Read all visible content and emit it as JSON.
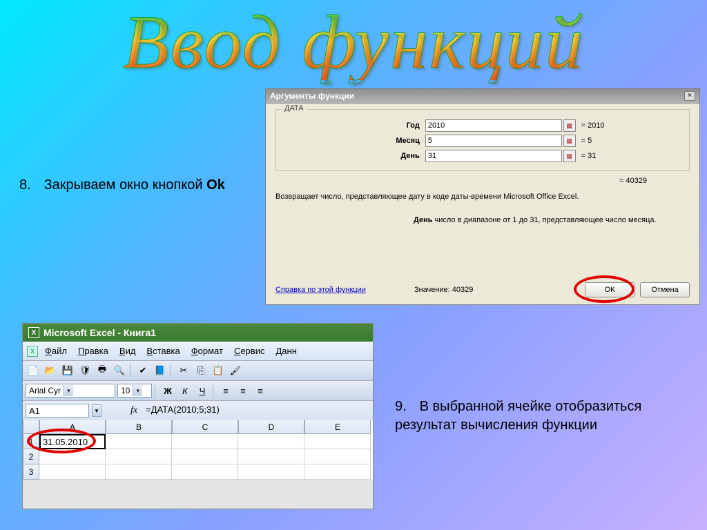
{
  "title": "Ввод функций",
  "instruction8": {
    "num": "8.",
    "text": "Закрываем окно кнопкой ",
    "bold": "Ok"
  },
  "instruction9": {
    "num": "9.",
    "text": "В выбранной ячейке отобразиться результат вычисления функции"
  },
  "dialog": {
    "title": "Аргументы функции",
    "group": "ДАТА",
    "args": [
      {
        "label": "Год",
        "value": "2010",
        "eq": "= 2010"
      },
      {
        "label": "Месяц",
        "value": "5",
        "eq": "= 5"
      },
      {
        "label": "День",
        "value": "31",
        "eq": "= 31"
      }
    ],
    "result_eq": "= 40329",
    "description": "Возвращает число, представляющее дату в коде даты-времени Microsoft Office Excel.",
    "param_help_label": "День",
    "param_help_text": "  число в диапазоне от 1 до 31, представляющее число месяца.",
    "help_link": "Справка по этой функции",
    "value_label": "Значение:",
    "value": "40329",
    "ok": "ОК",
    "cancel": "Отмена"
  },
  "excel": {
    "title": "Microsoft Excel - Книга1",
    "menu": [
      "Файл",
      "Правка",
      "Вид",
      "Вставка",
      "Формат",
      "Сервис",
      "Данн"
    ],
    "font": "Arial Cyr",
    "size": "10",
    "bold": "Ж",
    "italic": "К",
    "underline": "Ч",
    "namebox": "A1",
    "fx": "fx",
    "formula": "=ДАТА(2010;5;31)",
    "cols": [
      "A",
      "B",
      "C",
      "D",
      "E"
    ],
    "rows": [
      "1",
      "2",
      "3"
    ],
    "cellA1": "31.05.2010"
  }
}
